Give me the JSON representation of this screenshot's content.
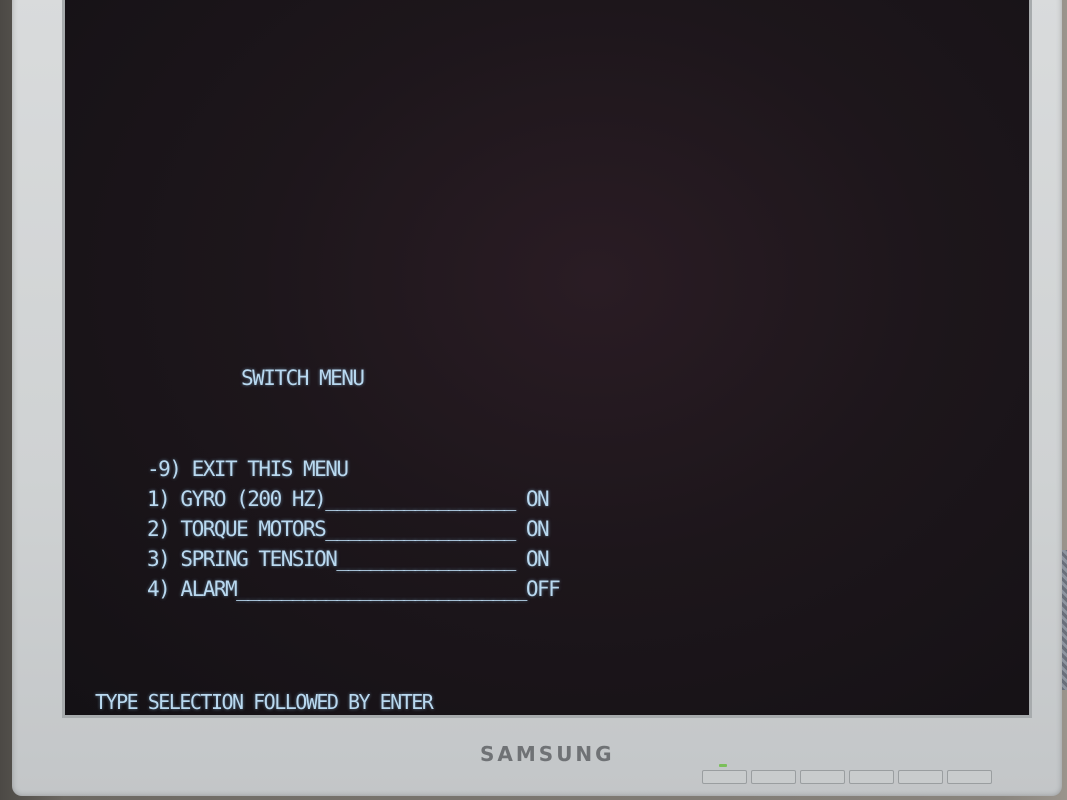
{
  "terminal": {
    "title": "SWITCH MENU",
    "items": [
      {
        "text": "-9) EXIT THIS MENU"
      },
      {
        "text": "1) GYRO (200 HZ)_________________ ON"
      },
      {
        "text": "2) TORQUE MOTORS_________________ ON"
      },
      {
        "text": "3) SPRING TENSION________________ ON"
      },
      {
        "text": "4) ALARM__________________________OFF"
      }
    ],
    "prompt": "TYPE SELECTION FOLLOWED BY ENTER"
  },
  "monitor": {
    "brand": "SAMSUNG",
    "button_icons": [
      "button",
      "button",
      "button",
      "button",
      "button",
      "button"
    ]
  },
  "colors": {
    "text": "#b9d9f0",
    "screen_bg": "#1d161b",
    "bezel": "#d6d8d9"
  }
}
